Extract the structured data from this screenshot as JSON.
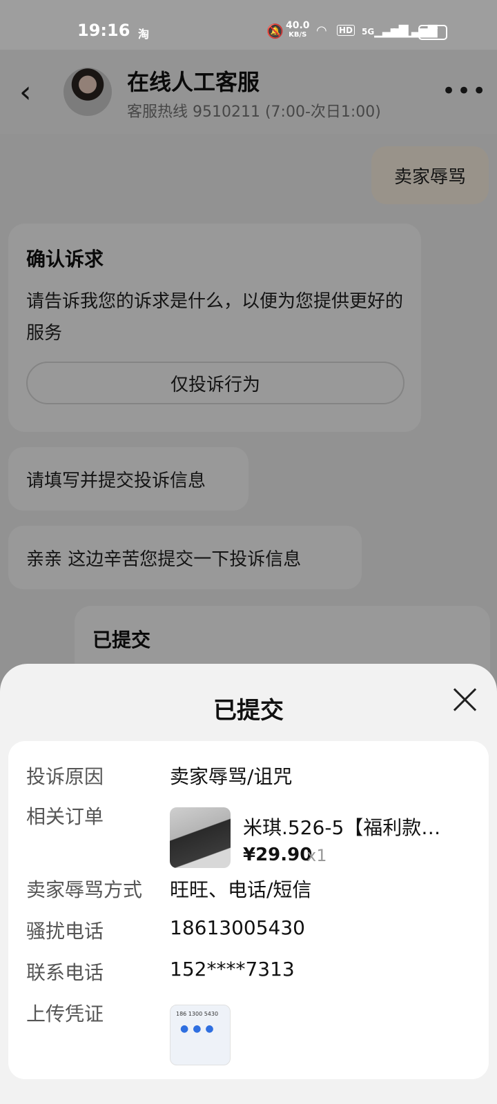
{
  "status_bar": {
    "time": "19:16",
    "app_icon_text": "淘",
    "net_speed": "40.0",
    "net_speed_unit": "KB/S",
    "hd_label": "HD",
    "signal1_label": "5G",
    "signal2_label": "4G",
    "battery": "97"
  },
  "header": {
    "title": "在线人工客服",
    "hotline": "客服热线 9510211 (7:00-次日1:00)"
  },
  "chat": {
    "user_message": "卖家辱骂",
    "card": {
      "title": "确认诉求",
      "text": "请告诉我您的诉求是什么，以便为您提供更好的服务",
      "button_label": "仅投诉行为"
    },
    "messages": [
      "请填写并提交投诉信息",
      "亲亲  这边辛苦您提交一下投诉信息"
    ],
    "submitted_card_title": "已提交"
  },
  "sheet": {
    "title": "已提交",
    "rows": {
      "reason_label": "投诉原因",
      "reason_value": "卖家辱骂/诅咒",
      "order_label": "相关订单",
      "product_name": "米琪.526-5【福利款…",
      "product_price": "¥29.90",
      "product_qty": "x1",
      "method_label": "卖家辱骂方式",
      "method_value": "旺旺、电话/短信",
      "harass_label": "骚扰电话",
      "harass_value": "18613005430",
      "contact_label": "联系电话",
      "contact_value": "152****7313",
      "proof_label": "上传凭证",
      "proof_thumb_text": "186 1300 5430"
    }
  }
}
